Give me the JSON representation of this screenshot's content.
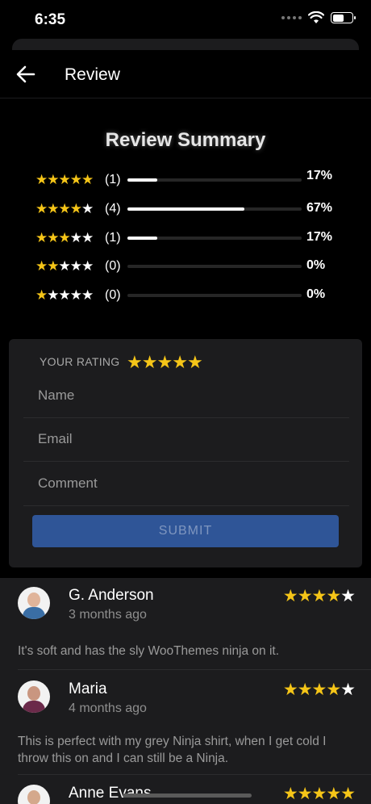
{
  "status_bar": {
    "time": "6:35"
  },
  "header": {
    "title": "Review",
    "back_icon": "arrow-left-icon"
  },
  "summary": {
    "title": "Review Summary",
    "rows": [
      {
        "stars": 5,
        "count": "(1)",
        "percent": "17%",
        "fraction": 0.17
      },
      {
        "stars": 4,
        "count": "(4)",
        "percent": "67%",
        "fraction": 0.67
      },
      {
        "stars": 3,
        "count": "(1)",
        "percent": "17%",
        "fraction": 0.17
      },
      {
        "stars": 2,
        "count": "(0)",
        "percent": "0%",
        "fraction": 0
      },
      {
        "stars": 1,
        "count": "(0)",
        "percent": "0%",
        "fraction": 0
      }
    ]
  },
  "form": {
    "your_rating_label": "YOUR RATING",
    "your_rating_value": 5,
    "name_placeholder": "Name",
    "email_placeholder": "Email",
    "comment_placeholder": "Comment",
    "submit_label": "SUBMIT"
  },
  "reviews": [
    {
      "name": "G. Anderson",
      "date": "3 months ago",
      "rating": 4,
      "text": "It's soft and has the sly WooThemes ninja on it."
    },
    {
      "name": "Maria",
      "date": "4 months ago",
      "rating": 4,
      "text": "This is perfect with my grey Ninja shirt, when I get cold I throw this on and I can still be a Ninja."
    },
    {
      "name": "Anne Evans",
      "date": "",
      "rating": 5,
      "text": ""
    }
  ],
  "colors": {
    "star": "#f5c518",
    "submit": "#2f5597",
    "card": "#1c1c1e"
  }
}
